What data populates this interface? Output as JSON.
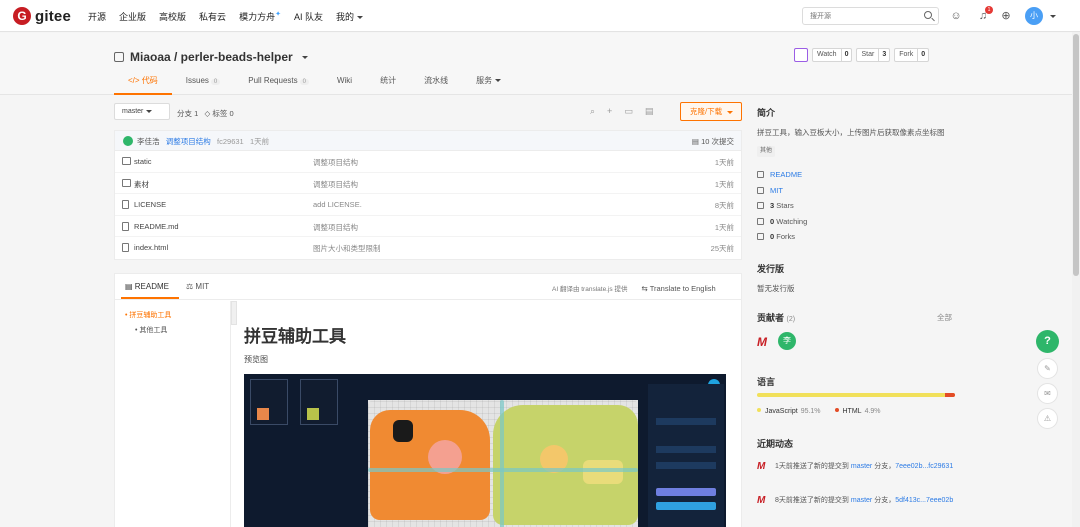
{
  "nav": {
    "logo_text": "gitee",
    "logo_letter": "G",
    "items": [
      "开源",
      "企业版",
      "高校版",
      "私有云",
      "模力方舟",
      "AI 队友",
      "我的"
    ],
    "search_placeholder": "搜开源",
    "notification_count": "1",
    "avatar_letter": "小"
  },
  "repo": {
    "title": "Miaoaa / perler-beads-helper",
    "actions": [
      {
        "label": "Watch",
        "count": "0"
      },
      {
        "label": "Star",
        "count": "3"
      },
      {
        "label": "Fork",
        "count": "0"
      }
    ],
    "tabs": [
      {
        "label": "代码",
        "count": ""
      },
      {
        "label": "Issues",
        "count": "0"
      },
      {
        "label": "Pull Requests",
        "count": "0"
      },
      {
        "label": "Wiki",
        "count": ""
      },
      {
        "label": "统计",
        "count": ""
      },
      {
        "label": "流水线",
        "count": ""
      },
      {
        "label": "服务",
        "count": ""
      }
    ]
  },
  "toolbar": {
    "branch": "master",
    "branches": "分支 1",
    "tags": "标签 0",
    "clone": "克隆/下载"
  },
  "commit": {
    "author": "李佳浩",
    "message": "调整项目结构",
    "sha": "fc29631",
    "time": "1天前",
    "count": "10 次提交"
  },
  "files": [
    {
      "name": "static",
      "message": "调整项目结构",
      "time": "1天前",
      "type": "folder"
    },
    {
      "name": "素材",
      "message": "调整项目结构",
      "time": "1天前",
      "type": "folder"
    },
    {
      "name": "LICENSE",
      "message": "add LICENSE.",
      "time": "8天前",
      "type": "doc"
    },
    {
      "name": "README.md",
      "message": "调整项目结构",
      "time": "1天前",
      "type": "doc"
    },
    {
      "name": "index.html",
      "message": "图片大小和类型限制",
      "time": "25天前",
      "type": "doc"
    }
  ],
  "readme": {
    "tab_readme": "README",
    "tab_license": "MIT",
    "translate_note": "AI 翻译由 translate.js 提供",
    "translate_en": "Translate to English",
    "toc": [
      "拼豆辅助工具",
      "其他工具"
    ],
    "h1": "拼豆辅助工具",
    "p": "预览图"
  },
  "sidebar": {
    "intro_h": "简介",
    "intro": "拼豆工具，输入豆板大小，上传图片后获取像素点坐标图",
    "tag": "其他",
    "readme": "README",
    "license": "MIT",
    "stars_n": "3",
    "stars_l": "Stars",
    "watching_n": "0",
    "watching_l": "Watching",
    "forks_n": "0",
    "forks_l": "Forks",
    "release_h": "发行版",
    "release": "暂无发行版",
    "contrib_h": "贡献者",
    "contrib_n": "(2)",
    "contrib_all": "全部",
    "contrib_letter": "李",
    "lang_h": "语言",
    "lang1": "JavaScript",
    "lang1_pct": "95.1%",
    "lang2": "HTML",
    "lang2_pct": "4.9%",
    "lang_js_fraction": 0.951,
    "activity_h": "近期动态",
    "activities": [
      {
        "prefix": "1天前推送了新的提交到",
        "branch": "master",
        "suffix": "分支，",
        "commit": "7eee02b...fc29631"
      },
      {
        "prefix": "8天前推送了新的提交到",
        "branch": "master",
        "suffix": "分支，",
        "commit": "5df413c...7eee02b"
      }
    ]
  },
  "colors": {
    "accent": "#fe7300",
    "brand": "#c71d23",
    "link": "#2c7be5",
    "js": "#f1e05a",
    "html": "#e34c26"
  }
}
